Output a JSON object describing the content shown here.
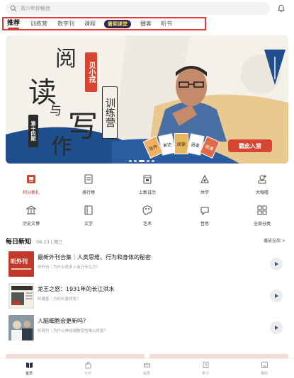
{
  "search": {
    "placeholder": "青少年抑郁症"
  },
  "tabs": [
    {
      "label": "推荐"
    },
    {
      "label": "训练营"
    },
    {
      "label": "数字刊"
    },
    {
      "label": "课程"
    },
    {
      "label": "暑期课堂"
    },
    {
      "label": "播客"
    },
    {
      "label": "听书"
    }
  ],
  "banner": {
    "title_chars": [
      "阅",
      "读",
      "与",
      "写",
      "作"
    ],
    "author": "贝小戎",
    "camp": "训练营",
    "issue": "第十四期",
    "cta": "戳此入营",
    "book_labels": [
      "写作",
      "表达",
      "阅读",
      "品鉴",
      "故事"
    ]
  },
  "categories": [
    {
      "label": "积分换礼",
      "icon": "gift-icon"
    },
    {
      "label": "排行榜",
      "icon": "ranking-icon"
    },
    {
      "label": "上新日历",
      "icon": "calendar-icon"
    },
    {
      "label": "共学",
      "icon": "study-together-icon"
    },
    {
      "label": "大咖嘻",
      "icon": "expert-icon"
    },
    {
      "label": "历史文博",
      "icon": "museum-icon"
    },
    {
      "label": "文学",
      "icon": "literature-icon"
    },
    {
      "label": "艺术",
      "icon": "art-palette-icon"
    },
    {
      "label": "哲思",
      "icon": "philosophy-icon"
    },
    {
      "label": "全部分类",
      "icon": "all-categories-icon"
    }
  ],
  "daily": {
    "title": "每日新知",
    "date": "08.23 | 周三",
    "play_all": "播放全部 >",
    "items": [
      {
        "title": "最新外刊合集｜人类思维、行为和身体的秘密",
        "subtitle": "听外刊｜为什么很多人自己专注力？",
        "thumb_text": "听外刊"
      },
      {
        "title": "龙王之怒：1931年的长江洪水",
        "subtitle": "听播客｜为何灾害频发？",
        "thumb_text": ""
      },
      {
        "title": "人脑细胞会更新吗?",
        "subtitle": "听周刊｜为什么神经细胞受伤难以修复？",
        "thumb_text": ""
      }
    ]
  },
  "bottom_nav": [
    {
      "label": "首页"
    },
    {
      "label": "七夕"
    },
    {
      "label": "会员"
    },
    {
      "label": "学习"
    },
    {
      "label": "我的"
    }
  ],
  "colors": {
    "accent": "#c0392b",
    "highlight_border": "#e53935",
    "cta": "#d64532"
  }
}
